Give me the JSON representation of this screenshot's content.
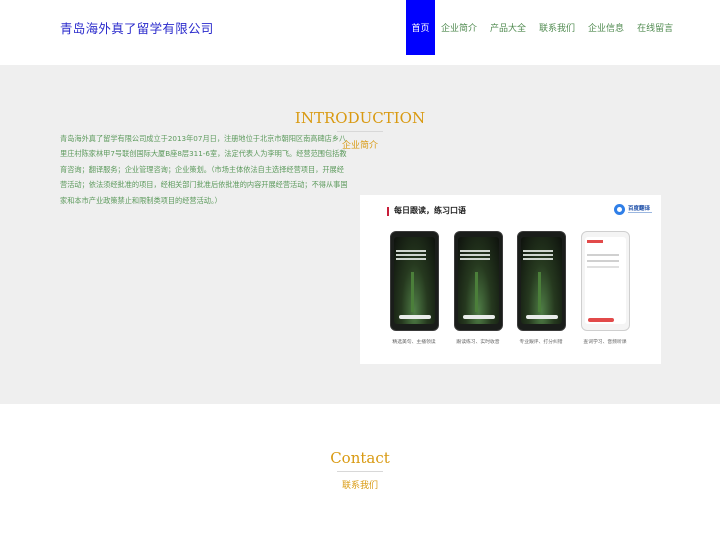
{
  "header": {
    "brand": "青岛海外真了留学有限公司",
    "nav": [
      "首页",
      "企业简介",
      "产品大全",
      "联系我们",
      "企业信息",
      "在线留言"
    ],
    "active_nav": "首页",
    "active_color": "#0000ff"
  },
  "intro": {
    "title": "INTRODUCTION",
    "subtitle": "企业简介",
    "text": "青岛海外真了留学有限公司成立于2013年07月日，注册地位于北京市朝阳区南高碑店乡八里庄村陈家林甲7号联创国际大厦B座8层311-6室，法定代表人为李明飞。经营范围包括教育咨询；翻译服务；企业管理咨询；企业策划。（市场主体依法自主选择经营项目，开展经营活动；依法须经批准的项目，经相关部门批准后依批准的内容开展经营活动；不得从事国家和本市产业政策禁止和限制类项目的经营活动。）",
    "image": {
      "heading": "每日跟读，练习口语",
      "logo_text": "百度翻译",
      "captions": [
        "精选美句、主播领读",
        "跟读练习、实时收音",
        "专业跟评、打分纠错",
        "查词学习、音频听课"
      ]
    }
  },
  "contact": {
    "title": "Contact",
    "subtitle": "联系我们"
  },
  "colors": {
    "accent": "#d99a12",
    "brand": "#2b2bcc",
    "nav_text": "#4f8a4f",
    "body_text": "#5c9a5c",
    "section_bg": "#efefef"
  }
}
